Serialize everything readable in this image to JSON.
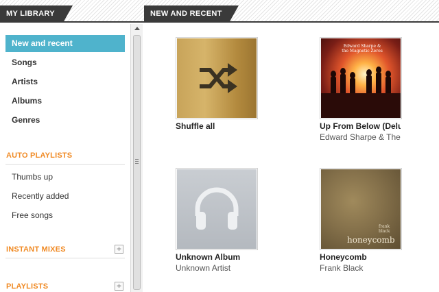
{
  "tabs": {
    "library": "MY LIBRARY",
    "recent": "NEW AND RECENT"
  },
  "sidebar": {
    "nav_items": [
      {
        "label": "New and recent",
        "active": true
      },
      {
        "label": "Songs",
        "active": false
      },
      {
        "label": "Artists",
        "active": false
      },
      {
        "label": "Albums",
        "active": false
      },
      {
        "label": "Genres",
        "active": false
      }
    ],
    "auto_playlists": {
      "heading": "AUTO PLAYLISTS",
      "items": [
        "Thumbs up",
        "Recently added",
        "Free songs"
      ]
    },
    "instant_mixes": {
      "heading": "INSTANT MIXES",
      "add_icon": "plus-icon"
    },
    "playlists": {
      "heading": "PLAYLISTS",
      "add_icon": "plus-icon"
    }
  },
  "albums": [
    {
      "title": "Shuffle all",
      "artist": "",
      "art": "shuffle-icon",
      "color": "#c8a45a"
    },
    {
      "title": "Up From Below (Delu",
      "artist": "Edward Sharpe & The",
      "art": "band-sunset-photo",
      "color": "#e0552b",
      "cover_text": "Edward Sharpe & the Magnetic Zeros"
    },
    {
      "title": "Unknown Album",
      "artist": "Unknown Artist",
      "art": "headphones-icon",
      "color": "#b4b9bf"
    },
    {
      "title": "Honeycomb",
      "artist": "Frank Black",
      "art": "textured-paper",
      "color": "#84704a",
      "cover_title": "honeycomb",
      "cover_artist": "frank black"
    }
  ],
  "colors": {
    "accent": "#4fb3cc",
    "section_heading": "#f08a24",
    "tab_bg": "#3a3a3a"
  }
}
